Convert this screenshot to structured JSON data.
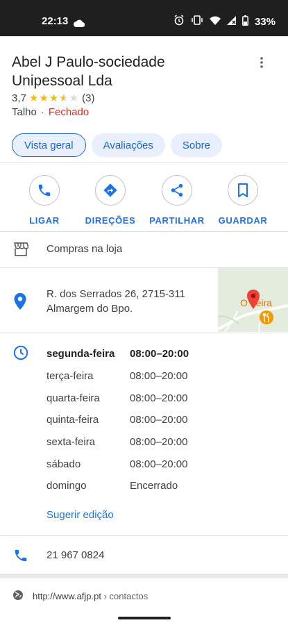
{
  "status_bar": {
    "time": "22:13",
    "battery": "33%"
  },
  "place": {
    "name": "Abel J Paulo-sociedade Unipessoal Lda",
    "rating": "3,7",
    "rating_value": 3.7,
    "review_count": "(3)",
    "category": "Talho",
    "separator": "·",
    "open_status": "Fechado"
  },
  "tabs": [
    {
      "label": "Vista geral",
      "active": true
    },
    {
      "label": "Avaliações"
    },
    {
      "label": "Sobre"
    }
  ],
  "actions": [
    {
      "label": "LIGAR",
      "icon": "phone-icon"
    },
    {
      "label": "DIREÇÕES",
      "icon": "directions-icon"
    },
    {
      "label": "PARTILHAR",
      "icon": "share-icon"
    },
    {
      "label": "GUARDAR",
      "icon": "bookmark-icon"
    }
  ],
  "service": "Compras na loja",
  "address": {
    "line1": "R. dos Serrados 26, 2715-311",
    "line2": "Almargem do Bpo."
  },
  "map": {
    "label": "O    neira"
  },
  "hours": [
    {
      "day": "segunda-feira",
      "time": "08:00–20:00",
      "today": true
    },
    {
      "day": "terça-feira",
      "time": "08:00–20:00"
    },
    {
      "day": "quarta-feira",
      "time": "08:00–20:00"
    },
    {
      "day": "quinta-feira",
      "time": "08:00–20:00"
    },
    {
      "day": "sexta-feira",
      "time": "08:00–20:00"
    },
    {
      "day": "sábado",
      "time": "08:00–20:00"
    },
    {
      "day": "domingo",
      "time": "Encerrado"
    }
  ],
  "suggest_edit": "Sugerir edição",
  "phone": "21 967 0824",
  "website": {
    "url": "http://www.afjp.pt",
    "path": " › contactos"
  },
  "colors": {
    "accent": "#1a73e8",
    "closed": "#d93025",
    "star": "#f6bb06"
  }
}
